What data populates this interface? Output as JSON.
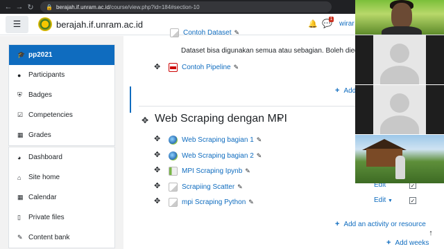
{
  "browser": {
    "url_host": "berajah.if.unram.ac.id",
    "url_path": "/course/view.php?id=184#section-10"
  },
  "navbar": {
    "site_name": "berajah.if.unram.ac.id",
    "chat_count": "1",
    "user_name": "wirar"
  },
  "drawer": {
    "course": "pp2021",
    "items": [
      {
        "label": "Participants",
        "icon": "users-icon"
      },
      {
        "label": "Badges",
        "icon": "shield-icon"
      },
      {
        "label": "Competencies",
        "icon": "check-square-icon"
      },
      {
        "label": "Grades",
        "icon": "table-icon"
      }
    ],
    "items2": [
      {
        "label": "Dashboard",
        "icon": "tachometer-icon"
      },
      {
        "label": "Site home",
        "icon": "home-icon"
      },
      {
        "label": "Calendar",
        "icon": "calendar-icon"
      },
      {
        "label": "Private files",
        "icon": "file-icon"
      },
      {
        "label": "Content bank",
        "icon": "paint-brush-icon"
      }
    ]
  },
  "section_prev": {
    "partial_title": "Contoh Dataset",
    "description": "Dataset bisa digunakan semua atau sebagian. Boleh diedit.",
    "pipeline": "Contoh Pipeline",
    "add_partial": "Add"
  },
  "section": {
    "title": "Web Scraping dengan MPI",
    "activities": [
      {
        "label": "Web Scraping bagian 1",
        "icon": "url-icon"
      },
      {
        "label": "Web Scraping bagian 2",
        "icon": "url-icon"
      },
      {
        "label": "MPI Scraping Ipynb",
        "icon": "code-file-icon"
      },
      {
        "label": "Scrapiing Scatter",
        "icon": "file-icon"
      },
      {
        "label": "mpi Scraping Python",
        "icon": "file-icon"
      }
    ],
    "edit_label": "Edit",
    "add_activity": "Add an activity or resource",
    "add_weeks": "Add weeks"
  }
}
